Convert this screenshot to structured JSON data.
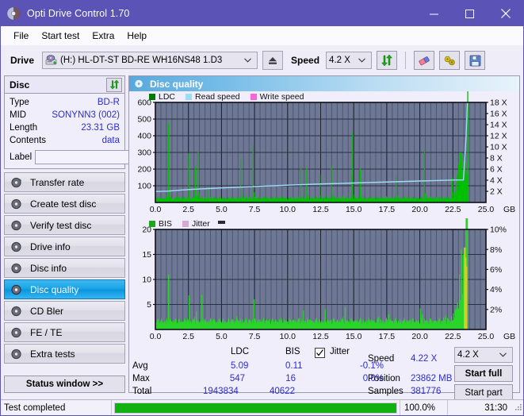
{
  "window": {
    "title": "Opti Drive Control 1.70",
    "icon": "disc-icon",
    "minimize": "minimize-icon",
    "maximize": "maximize-icon",
    "close": "close-icon"
  },
  "menu": {
    "items": [
      {
        "label": "File"
      },
      {
        "label": "Start test"
      },
      {
        "label": "Extra"
      },
      {
        "label": "Help"
      }
    ]
  },
  "toolbar": {
    "drive_label": "Drive",
    "drive_value": "(H:)   HL-DT-ST BD-RE  WH16NS48 1.D3",
    "eject_icon": "eject-icon",
    "speed_label": "Speed",
    "speed_value": "4.2 X",
    "refresh_icon": "refresh-icon",
    "erase_icon": "eraser-icon",
    "settings_icon": "tools-icon",
    "save_icon": "save-icon"
  },
  "disc_panel": {
    "title": "Disc",
    "refresh_icon": "refresh-icon",
    "rows": [
      {
        "key": "Type",
        "value": "BD-R"
      },
      {
        "key": "MID",
        "value": "SONYNN3 (002)"
      },
      {
        "key": "Length",
        "value": "23.31 GB"
      },
      {
        "key": "Contents",
        "value": "data"
      }
    ],
    "label_key": "Label",
    "label_value": "",
    "label_placeholder": "",
    "label_button_icon": "disc-icon"
  },
  "sidebar": {
    "items": [
      {
        "label": "Transfer rate",
        "icon": "disc-icon",
        "active": false
      },
      {
        "label": "Create test disc",
        "icon": "disc-icon",
        "active": false
      },
      {
        "label": "Verify test disc",
        "icon": "disc-icon",
        "active": false
      },
      {
        "label": "Drive info",
        "icon": "disc-icon",
        "active": false
      },
      {
        "label": "Disc info",
        "icon": "disc-icon",
        "active": false
      },
      {
        "label": "Disc quality",
        "icon": "disc-icon",
        "active": true
      },
      {
        "label": "CD Bler",
        "icon": "disc-icon",
        "active": false
      },
      {
        "label": "FE / TE",
        "icon": "disc-icon",
        "active": false
      },
      {
        "label": "Extra tests",
        "icon": "disc-icon",
        "active": false
      }
    ],
    "status_window": "Status window >>"
  },
  "content": {
    "title": "Disc quality",
    "icon": "disc-icon"
  },
  "stats": {
    "col_headers": [
      "LDC",
      "BIS"
    ],
    "row_headers": [
      "Avg",
      "Max",
      "Total"
    ],
    "ldc": {
      "avg": "5.09",
      "max": "547",
      "total": "1943834"
    },
    "bis": {
      "avg": "0.11",
      "max": "16",
      "total": "40622"
    },
    "jitter_label": "Jitter",
    "jitter_checked": true,
    "jitter_avg": "-0.1%",
    "jitter_max": "0.0%",
    "speed_label": "Speed",
    "speed_value": "4.22 X",
    "position_label": "Position",
    "position_value": "23862 MB",
    "samples_label": "Samples",
    "samples_value": "381776",
    "speed_select": "4.2 X",
    "start_full": "Start full",
    "start_part": "Start part"
  },
  "statusbar": {
    "text": "Test completed",
    "percent_text": "100.0%",
    "percent_value": 100,
    "time": "31:30"
  },
  "colors": {
    "accent": "#5b53b5",
    "ldc_green": "#00b400",
    "ldc_green_bright": "#22dd22",
    "read_speed": "#8fd8f5",
    "write_speed": "#ff63d8",
    "bis_green": "#22cc22",
    "jitter_pink": "#d8a8d8",
    "plot_bg": "#6a7491",
    "link_blue": "#2d2dd0",
    "progress_green": "#12b112"
  },
  "chart_data": [
    {
      "type": "line",
      "name": "LDC / Read speed",
      "title": "",
      "xlabel": "GB",
      "ylabel": "",
      "xlim": [
        0,
        25
      ],
      "ylim": [
        0,
        600
      ],
      "y2lim": [
        0,
        18
      ],
      "y2label": "X",
      "grid": true,
      "legend": [
        "LDC",
        "Read speed",
        "Write speed"
      ],
      "legend_position": "top-left",
      "xticks": [
        "0.0",
        "2.5",
        "5.0",
        "7.5",
        "10.0",
        "12.5",
        "15.0",
        "17.5",
        "20.0",
        "22.5",
        "25.0"
      ],
      "yticks": [
        "100",
        "200",
        "300",
        "400",
        "500",
        "600"
      ],
      "y2ticks": [
        "2 X",
        "4 X",
        "6 X",
        "8 X",
        "10 X",
        "12 X",
        "14 X",
        "16 X",
        "18 X"
      ],
      "series": [
        {
          "name": "LDC",
          "color": "#00c000",
          "style": "impulse",
          "x": [
            0.05,
            0.18,
            0.32,
            0.45,
            0.58,
            0.72,
            0.86,
            1.0,
            1.06,
            1.14,
            1.28,
            1.42,
            1.56,
            1.7,
            1.84,
            1.98,
            2.12,
            2.26,
            2.4,
            2.52,
            2.6,
            2.74,
            2.88,
            3.02,
            3.16,
            3.22,
            3.3,
            3.44,
            3.58,
            3.72,
            3.86,
            3.95,
            4.05,
            4.2,
            4.35,
            4.5,
            4.65,
            4.8,
            4.95,
            5.1,
            5.25,
            5.4,
            5.55,
            5.7,
            5.85,
            6.0,
            6.15,
            6.3,
            6.45,
            6.6,
            6.68,
            6.8,
            6.95,
            7.1,
            7.25,
            7.4,
            7.47,
            7.55,
            7.7,
            7.85,
            8.0,
            8.15,
            8.3,
            8.45,
            8.6,
            8.75,
            8.9,
            9.05,
            9.2,
            9.35,
            9.5,
            9.65,
            9.8,
            9.95,
            10.1,
            10.25,
            10.4,
            10.55,
            10.7,
            10.85,
            11.0,
            11.15,
            11.3,
            11.45,
            11.52,
            11.6,
            11.75,
            11.9,
            12.05,
            12.2,
            12.35,
            12.45,
            12.55,
            12.7,
            12.85,
            13.0,
            13.15,
            13.3,
            13.45,
            13.55,
            13.65,
            13.8,
            13.95,
            14.1,
            14.25,
            14.4,
            14.55,
            14.7,
            14.85,
            14.92,
            15.05,
            15.2,
            15.35,
            15.5,
            15.65,
            15.8,
            15.95,
            16.1,
            16.25,
            16.4,
            16.55,
            16.7,
            16.85,
            17.0,
            17.15,
            17.3,
            17.45,
            17.6,
            17.75,
            17.9,
            18.05,
            18.2,
            18.35,
            18.45,
            18.55,
            18.7,
            18.85,
            19.0,
            19.15,
            19.3,
            19.45,
            19.6,
            19.75,
            19.9,
            20.05,
            20.2,
            20.35,
            20.42,
            20.5,
            20.65,
            20.8,
            20.95,
            21.1,
            21.25,
            21.4,
            21.55,
            21.7,
            21.85,
            22.0,
            22.15,
            22.3,
            22.45,
            22.55,
            22.65,
            22.75,
            22.85,
            22.95,
            23.05,
            23.15,
            23.25,
            23.35,
            23.45,
            23.52,
            23.58,
            23.62
          ],
          "y": [
            25,
            18,
            22,
            30,
            24,
            28,
            20,
            476,
            60,
            22,
            26,
            18,
            24,
            30,
            20,
            26,
            22,
            18,
            24,
            295,
            70,
            30,
            26,
            212,
            40,
            310,
            55,
            28,
            24,
            30,
            22,
            88,
            26,
            20,
            24,
            30,
            26,
            22,
            28,
            24,
            30,
            22,
            26,
            24,
            28,
            22,
            30,
            24,
            265,
            48,
            26,
            22,
            28,
            24,
            30,
            344,
            60,
            26,
            22,
            28,
            24,
            30,
            26,
            22,
            28,
            24,
            30,
            26,
            22,
            28,
            24,
            30,
            26,
            22,
            28,
            24,
            30,
            26,
            22,
            28,
            212,
            36,
            24,
            205,
            40,
            26,
            22,
            28,
            24,
            30,
            26,
            168,
            42,
            28,
            24,
            30,
            26,
            218,
            40,
            26,
            22,
            28,
            24,
            30,
            26,
            22,
            28,
            24,
            162,
            420,
            45,
            30,
            26,
            202,
            40,
            26,
            22,
            28,
            24,
            30,
            26,
            22,
            28,
            24,
            30,
            26,
            22,
            28,
            24,
            30,
            26,
            155,
            40,
            26,
            22,
            28,
            24,
            30,
            26,
            22,
            28,
            24,
            30,
            26,
            22,
            28,
            315,
            55,
            30,
            26,
            22,
            28,
            24,
            30,
            26,
            22,
            28,
            24,
            30,
            26,
            22,
            150,
            60,
            80,
            120,
            170,
            230,
            300,
            290,
            190,
            250,
            310,
            180,
            120
          ]
        },
        {
          "name": "Read speed",
          "color": "#9ddcf6",
          "style": "line",
          "x": [
            0.0,
            1.0,
            2.0,
            3.0,
            4.0,
            5.0,
            6.0,
            7.0,
            8.0,
            9.0,
            10.0,
            11.0,
            12.0,
            13.0,
            14.0,
            15.0,
            16.0,
            17.0,
            18.0,
            19.0,
            20.0,
            21.0,
            22.0,
            22.8,
            23.3,
            23.5,
            23.6
          ],
          "y_in_x": [
            1.95,
            2.05,
            2.25,
            2.38,
            2.5,
            2.62,
            2.72,
            2.82,
            2.92,
            3.02,
            3.12,
            3.2,
            3.28,
            3.35,
            3.42,
            3.5,
            3.58,
            3.65,
            3.72,
            3.78,
            3.85,
            3.92,
            3.98,
            4.05,
            4.05,
            12.0,
            18.0
          ]
        },
        {
          "name": "Write speed",
          "color": "#ff63d8",
          "style": "line",
          "x": [],
          "y": []
        }
      ]
    },
    {
      "type": "line",
      "name": "BIS / Jitter",
      "title": "",
      "xlabel": "GB",
      "ylabel": "",
      "xlim": [
        0,
        25
      ],
      "ylim": [
        0,
        20
      ],
      "y2lim": [
        0,
        10
      ],
      "y2label": "%",
      "grid": true,
      "legend": [
        "BIS",
        "Jitter"
      ],
      "legend_position": "top-left",
      "xticks": [
        "0.0",
        "2.5",
        "5.0",
        "7.5",
        "10.0",
        "12.5",
        "15.0",
        "17.5",
        "20.0",
        "22.5",
        "25.0"
      ],
      "yticks": [
        "5",
        "10",
        "15",
        "20"
      ],
      "y2ticks": [
        "2%",
        "4%",
        "6%",
        "8%",
        "10%"
      ],
      "series": [
        {
          "name": "BIS",
          "color": "#2ad42a",
          "style": "impulse",
          "x": [
            0.05,
            0.18,
            0.32,
            0.45,
            0.58,
            0.72,
            0.86,
            1.0,
            1.08,
            1.2,
            1.34,
            1.48,
            1.62,
            1.76,
            1.9,
            2.04,
            2.18,
            2.32,
            2.46,
            2.54,
            2.68,
            2.82,
            2.96,
            3.1,
            3.24,
            3.38,
            3.52,
            3.66,
            3.8,
            3.95,
            4.05,
            4.2,
            4.35,
            4.5,
            4.65,
            4.8,
            4.95,
            5.1,
            5.25,
            5.4,
            5.55,
            5.7,
            5.85,
            6.0,
            6.15,
            6.3,
            6.45,
            6.6,
            6.75,
            6.9,
            7.05,
            7.2,
            7.35,
            7.47,
            7.6,
            7.75,
            7.9,
            8.05,
            8.2,
            8.35,
            8.5,
            8.65,
            8.8,
            8.95,
            9.1,
            9.25,
            9.4,
            9.55,
            9.7,
            9.85,
            10.0,
            10.15,
            10.3,
            10.45,
            10.6,
            10.75,
            10.9,
            11.05,
            11.2,
            11.35,
            11.5,
            11.65,
            11.8,
            11.95,
            12.1,
            12.25,
            12.4,
            12.55,
            12.7,
            12.85,
            13.0,
            13.15,
            13.3,
            13.45,
            13.6,
            13.75,
            13.9,
            14.05,
            14.2,
            14.35,
            14.5,
            14.65,
            14.8,
            14.95,
            15.1,
            15.25,
            15.4,
            15.55,
            15.7,
            15.85,
            16.0,
            16.15,
            16.3,
            16.45,
            16.6,
            16.75,
            16.9,
            17.05,
            17.2,
            17.35,
            17.5,
            17.65,
            17.8,
            17.95,
            18.1,
            18.25,
            18.4,
            18.55,
            18.7,
            18.85,
            19.0,
            19.15,
            19.3,
            19.45,
            19.6,
            19.75,
            19.9,
            20.05,
            20.2,
            20.35,
            20.45,
            20.6,
            20.75,
            20.9,
            21.05,
            21.2,
            21.35,
            21.5,
            21.65,
            21.8,
            21.95,
            22.1,
            22.25,
            22.4,
            22.55,
            22.7,
            22.85,
            23.0,
            23.15,
            23.3,
            23.4,
            23.5,
            23.55,
            23.6
          ],
          "y": [
            1.2,
            1.5,
            1.3,
            1.6,
            1.4,
            1.8,
            1.5,
            11.0,
            1.6,
            1.4,
            1.8,
            1.5,
            1.3,
            1.7,
            1.5,
            1.6,
            1.4,
            1.8,
            1.5,
            6.8,
            1.7,
            1.5,
            2.5,
            3.6,
            1.8,
            1.6,
            6.9,
            2.0,
            1.7,
            1.5,
            1.8,
            1.6,
            2.0,
            1.7,
            1.5,
            1.8,
            1.6,
            2.0,
            1.7,
            1.5,
            1.8,
            1.6,
            2.0,
            1.7,
            2.6,
            1.8,
            1.6,
            2.0,
            1.7,
            1.5,
            1.8,
            1.6,
            2.0,
            6.0,
            1.8,
            1.6,
            2.0,
            1.7,
            1.5,
            1.8,
            1.6,
            2.0,
            1.7,
            1.5,
            1.8,
            1.6,
            2.0,
            1.7,
            1.5,
            1.8,
            1.6,
            2.0,
            1.7,
            1.5,
            1.8,
            1.6,
            2.0,
            1.7,
            3.8,
            1.8,
            1.6,
            2.0,
            1.7,
            1.5,
            1.8,
            1.6,
            2.0,
            1.7,
            1.5,
            4.0,
            1.8,
            1.6,
            2.0,
            1.7,
            1.5,
            1.8,
            1.6,
            2.0,
            1.7,
            4.5,
            1.8,
            1.6,
            2.0,
            1.7,
            1.5,
            1.8,
            1.6,
            2.0,
            1.7,
            1.5,
            1.8,
            1.6,
            2.0,
            1.7,
            1.5,
            1.8,
            2.5,
            2.0,
            1.7,
            1.5,
            1.8,
            3.0,
            2.0,
            1.7,
            1.5,
            1.8,
            1.6,
            2.0,
            1.7,
            1.5,
            1.8,
            1.6,
            2.0,
            1.7,
            1.5,
            1.8,
            1.6,
            4.2,
            3.0,
            2.2,
            1.8,
            1.6,
            2.0,
            1.7,
            1.5,
            1.8,
            1.6,
            2.0,
            1.7,
            2.4,
            2.8,
            2.2,
            1.8,
            2.6,
            3.2,
            4.0,
            5.4,
            11.0,
            16.0,
            15.0,
            8.0
          ]
        },
        {
          "name": "Jitter",
          "color": "#cfcf2a",
          "style": "impulse",
          "x": [
            23.4,
            23.46,
            23.52
          ],
          "y_pct": [
            8.2,
            7.2,
            6.3
          ]
        }
      ]
    }
  ]
}
